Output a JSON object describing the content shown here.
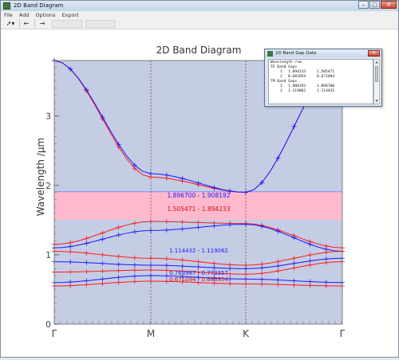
{
  "window": {
    "title": "2D Band Diagram",
    "buttons": {
      "minimize": "–",
      "maximize": "□",
      "close": "✕"
    }
  },
  "menu": [
    "File",
    "Add",
    "Options",
    "Export"
  ],
  "toolbar": {
    "pointer": "➚▾",
    "back": "←",
    "forward": "→"
  },
  "plot": {
    "title": "2D Band Diagram",
    "ylabel": "Wavelength /µm",
    "y_ticks": [
      "0",
      "1",
      "2",
      "3"
    ],
    "x_ticks": [
      "Γ",
      "M",
      "K",
      "Γ"
    ],
    "gap_labels": {
      "te_gap1": "1.505471 - 1.894233",
      "tm_gap1": "1.896700 - 1.908192",
      "te_gap2": "0.671094 - 0.683954",
      "tm_gap2": "1.114432 - 1.119062",
      "tm_gap2b": "0.763987 - 0.773357"
    },
    "colors": {
      "background": "#c5cde5",
      "gap_band": "#ffb9cc",
      "te_series": "#ff1a1a",
      "tm_series": "#1a1aff"
    }
  },
  "chart_data": {
    "type": "line",
    "title": "2D Band Diagram",
    "xlabel": "",
    "ylabel": "Wavelength /µm",
    "x_categories": [
      "Γ",
      "M",
      "K",
      "Γ"
    ],
    "ylim": [
      0,
      3.8
    ],
    "gap_band": [
      1.505471,
      1.908192
    ],
    "series": [
      {
        "values_at_ticks": [
          3.8,
          2.12,
          1.9,
          3.8
        ]
      },
      {
        "values_at_ticks": [
          3.8,
          2.17,
          1.9,
          3.8
        ]
      },
      {
        "values_at_ticks": [
          1.15,
          1.48,
          1.45,
          1.1
        ]
      },
      {
        "values_at_ticks": [
          1.1,
          1.35,
          1.44,
          1.05
        ]
      },
      {
        "values_at_ticks": [
          1.05,
          0.95,
          0.85,
          1.05
        ]
      },
      {
        "values_at_ticks": [
          0.9,
          0.85,
          0.8,
          0.95
        ]
      },
      {
        "values_at_ticks": [
          0.75,
          0.78,
          0.72,
          0.9
        ]
      },
      {
        "values_at_ticks": [
          0.6,
          0.7,
          0.65,
          0.6
        ]
      },
      {
        "values_at_ticks": [
          0.55,
          0.62,
          0.58,
          0.55
        ]
      }
    ]
  },
  "gap_popup": {
    "title": "2D Band Gap Data",
    "lines": [
      {
        "c0": "Wavelength /um",
        "c1": "",
        "c2": "",
        "c3": ""
      },
      {
        "c0": "TE Band Gaps",
        "c1": "",
        "c2": "",
        "c3": ""
      },
      {
        "c0": "",
        "c1": "1",
        "c2": "1.894233",
        "c3": "1.505471"
      },
      {
        "c0": "",
        "c1": "2",
        "c2": "0.683954",
        "c3": "0.671094"
      },
      {
        "c0": "TM Band Gaps",
        "c1": "",
        "c2": "",
        "c3": ""
      },
      {
        "c0": "",
        "c1": "1",
        "c2": "1.908192",
        "c3": "1.896700"
      },
      {
        "c0": "",
        "c1": "2",
        "c2": "1.119062",
        "c3": "1.114432"
      }
    ],
    "close_label": "✕"
  }
}
